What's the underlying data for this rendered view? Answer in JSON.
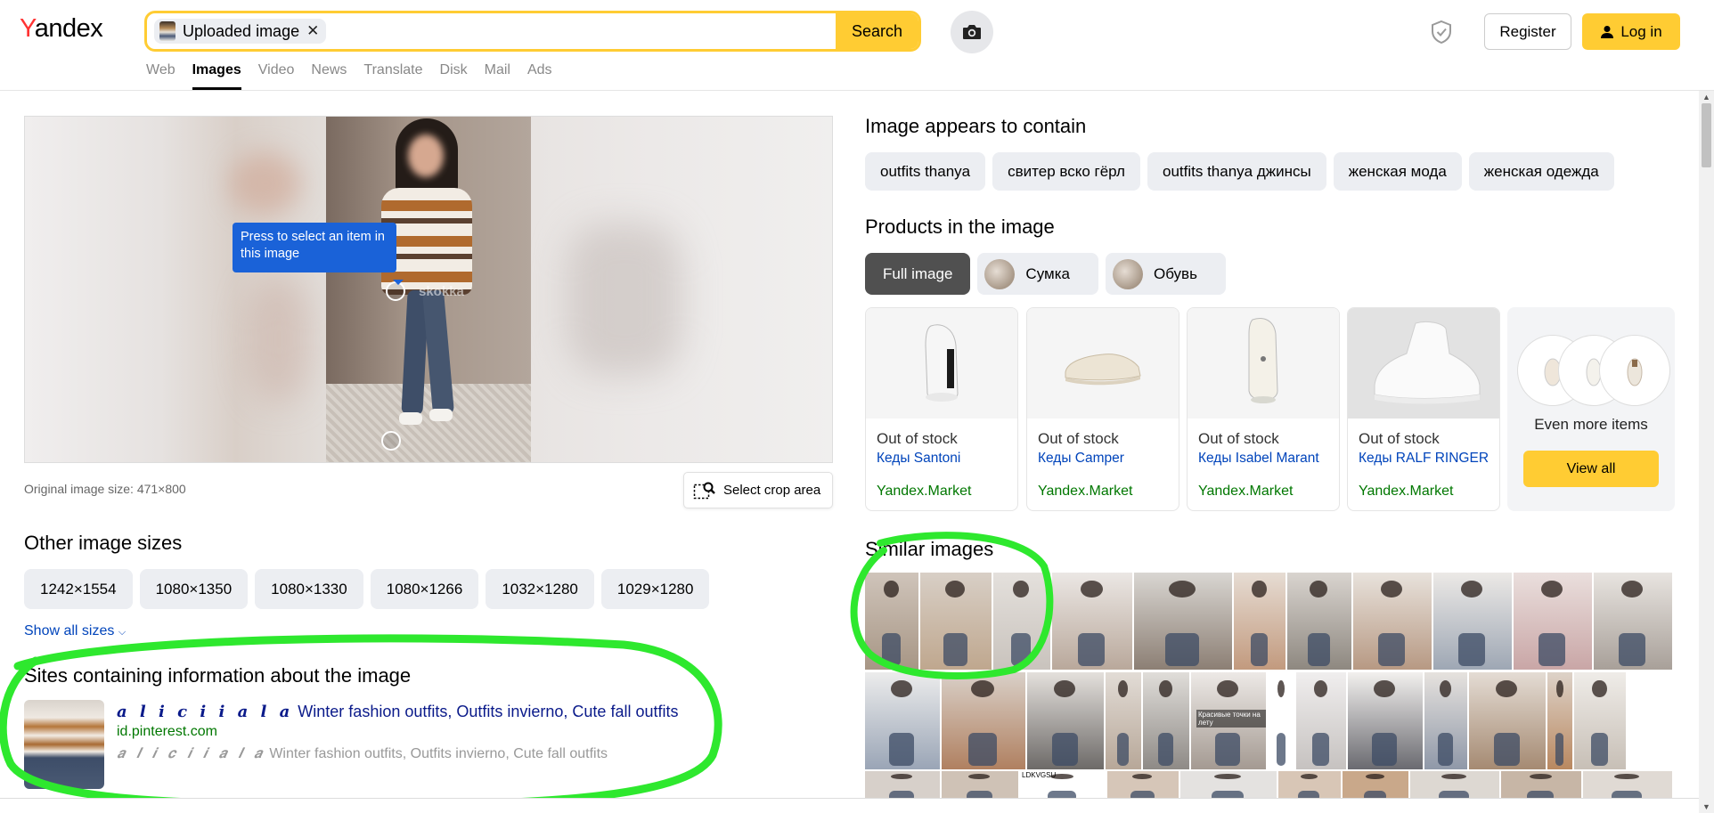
{
  "header": {
    "logo": "Yandex",
    "logo_first": "Y",
    "logo_rest": "andex",
    "uploaded_chip": "Uploaded image",
    "uploaded_close": "✕",
    "search_button": "Search",
    "register": "Register",
    "login": "Log in"
  },
  "nav": {
    "tabs": [
      "Web",
      "Images",
      "Video",
      "News",
      "Translate",
      "Disk",
      "Mail",
      "Ads"
    ],
    "active": "Images"
  },
  "main_image": {
    "tooltip": "Press to select an item in this image",
    "watermark": "skokka",
    "original_size": "Original image size: 471×800",
    "crop_button": "Select crop area"
  },
  "other_sizes": {
    "title": "Other image sizes",
    "sizes": [
      "1242×1554",
      "1080×1350",
      "1080×1330",
      "1080×1266",
      "1032×1280",
      "1029×1280"
    ],
    "show_all": "Show all sizes"
  },
  "sites": {
    "title": "Sites containing information about the image",
    "items": [
      {
        "title_stylized": "𝒂 𝒍 𝒊 𝒄 𝒊 𝒊 𝒂 𝒍 𝒂",
        "title": "Winter fashion outfits, Outfits invierno, Cute fall outfits",
        "domain": "id.pinterest.com",
        "desc_stylized": "𝒂 𝒍 𝒊 𝒄 𝒊 𝒊 𝒂 𝒍 𝒂",
        "desc": "Winter fashion outfits, Outfits invierno, Cute fall outfits"
      }
    ]
  },
  "contains": {
    "title": "Image appears to contain",
    "tags": [
      "outfits thanya",
      "свитер вско гёрл",
      "outfits thanya джинсы",
      "женская мода",
      "женская одежда"
    ]
  },
  "products": {
    "title": "Products in the image",
    "tabs": [
      "Full image",
      "Сумка",
      "Обувь"
    ],
    "active_tab": "Full image",
    "items": [
      {
        "stock": "Out of stock",
        "name": "Кеды Santoni",
        "market": "Yandex.Market"
      },
      {
        "stock": "Out of stock",
        "name": "Кеды Camper",
        "market": "Yandex.Market"
      },
      {
        "stock": "Out of stock",
        "name": "Кеды Isabel Marant",
        "market": "Yandex.Market"
      },
      {
        "stock": "Out of stock",
        "name": "Кеды RALF RINGER",
        "market": "Yandex.Market"
      }
    ],
    "more_text": "Even more items",
    "view_all": "View all"
  },
  "similar": {
    "title": "Similar images",
    "caption_text": "Красивые точки на лету",
    "tiny_label": "LDKVGSU"
  },
  "colors": {
    "accent_yellow": "#ffcc33",
    "logo_red": "#ff3333",
    "link_blue": "#0044bb",
    "domain_green": "#007700",
    "annotation_green": "#2ee82e",
    "tooltip_blue": "#1a62d8"
  }
}
